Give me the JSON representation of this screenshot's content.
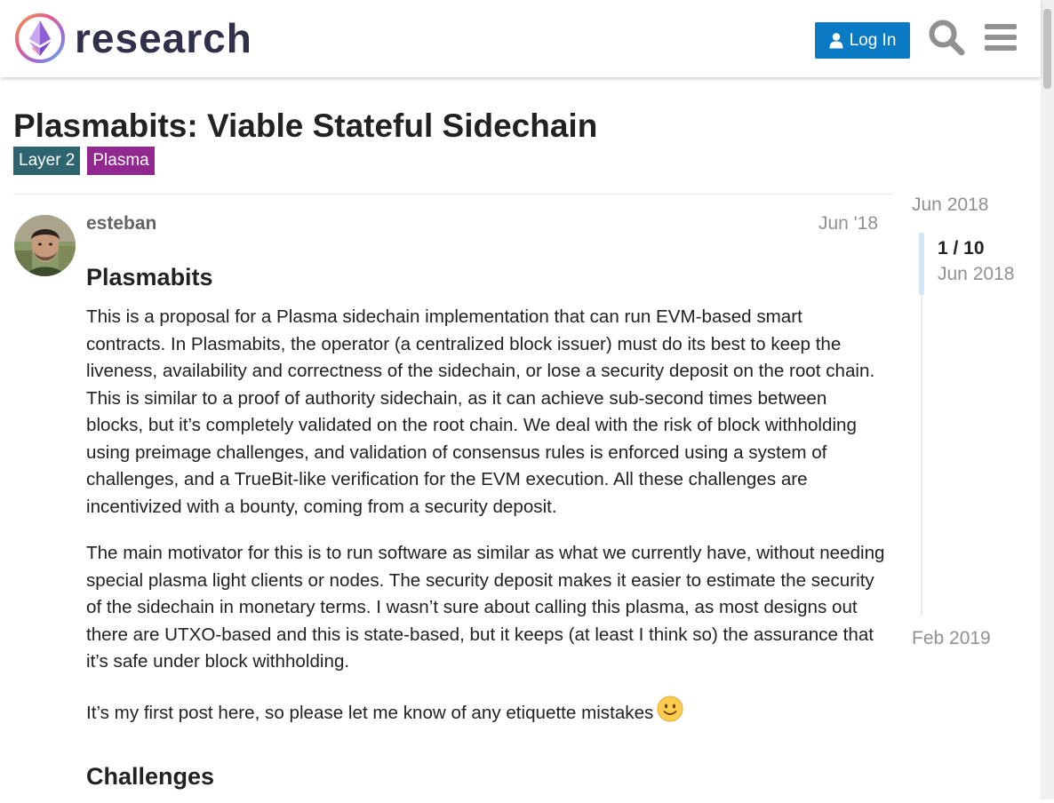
{
  "header": {
    "logo_text": "research",
    "login_label": "Log In",
    "colors": {
      "login_bg": "#0a7ac4",
      "logo_text": "#30304a"
    }
  },
  "topic": {
    "title": "Plasmabits: Viable Stateful Sidechain",
    "tags": [
      {
        "label": "Layer 2",
        "color": "#2e6470"
      },
      {
        "label": "Plasma",
        "color": "#92278f"
      }
    ]
  },
  "post": {
    "username": "esteban",
    "date": "Jun '18",
    "heading": "Plasmabits",
    "paragraphs": [
      "This is a proposal for a Plasma sidechain implementation that can run EVM-based smart contracts. In Plasmabits, the operator (a centralized block issuer) must do its best to keep the liveness, availability and correctness of the sidechain, or lose a security deposit on the root chain. This is similar to a proof of authority sidechain, as it can achieve sub-second times between blocks, but it’s completely validated on the root chain. We deal with the risk of block withholding using preimage challenges, and validation of consensus rules is enforced using a system of challenges, and a TrueBit-like verification for the EVM execution. All these challenges are incentivized with a bounty, coming from a security deposit.",
      "The main motivator for this is to run software as similar as what we currently have, without needing special plasma light clients or nodes. The security deposit makes it easier to estimate the security of the sidechain in monetary terms. I wasn’t sure about calling this plasma, as most designs out there are UTXO-based and this is state-based, but it keeps (at least I think so) the assurance that it’s safe under block withholding.",
      "It’s my first post here, so please let me know of any etiquette mistakes"
    ],
    "emoji": "slight_smile",
    "subheading": "Challenges"
  },
  "timeline": {
    "start_date": "Jun 2018",
    "position": "1 / 10",
    "position_date": "Jun 2018",
    "end_date": "Feb 2019"
  }
}
